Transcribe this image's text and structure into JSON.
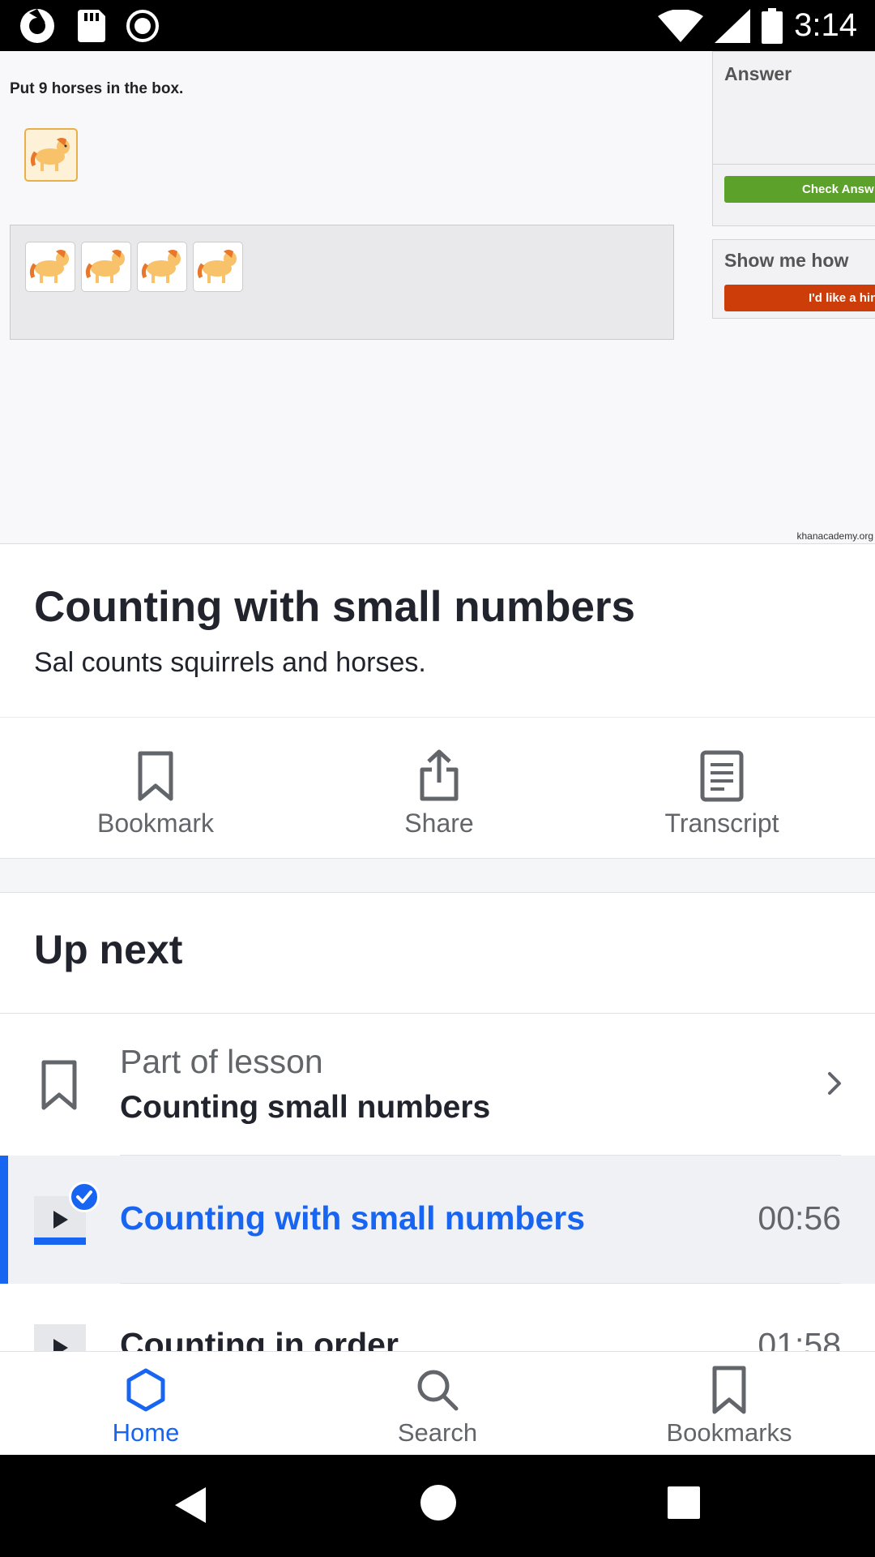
{
  "status_bar": {
    "time": "3:14",
    "icons": [
      "camera-app-icon",
      "sd-card-icon",
      "record-icon",
      "wifi-icon",
      "cell-signal-icon",
      "battery-icon"
    ]
  },
  "video": {
    "prompt": "Put 9 horses in the box.",
    "answer_title": "Answer",
    "check_answer_label": "Check Answ",
    "show_me_how_title": "Show me how",
    "hint_label": "I'd like a hin",
    "watermark": "khanacademy.org",
    "horse_count_in_box": 4,
    "colors": {
      "check": "#5ca12a",
      "hint": "#cc3d0a"
    }
  },
  "content": {
    "title": "Counting with small numbers",
    "description": "Sal counts squirrels and horses."
  },
  "actions": [
    {
      "label": "Bookmark",
      "icon": "bookmark-icon"
    },
    {
      "label": "Share",
      "icon": "share-icon"
    },
    {
      "label": "Transcript",
      "icon": "transcript-icon"
    }
  ],
  "up_next": {
    "heading": "Up next",
    "lesson_kicker": "Part of lesson",
    "lesson_name": "Counting small numbers",
    "items": [
      {
        "title": "Counting with small numbers",
        "duration": "00:56",
        "active": true,
        "completed": true
      },
      {
        "title": "Counting in order",
        "duration": "01:58",
        "active": false,
        "completed": false
      }
    ]
  },
  "bottom_nav": [
    {
      "label": "Home",
      "icon": "home-hexagon-icon",
      "active": true
    },
    {
      "label": "Search",
      "icon": "search-icon",
      "active": false
    },
    {
      "label": "Bookmarks",
      "icon": "bookmark-icon",
      "active": false
    }
  ],
  "accent_color": "#1865f2"
}
